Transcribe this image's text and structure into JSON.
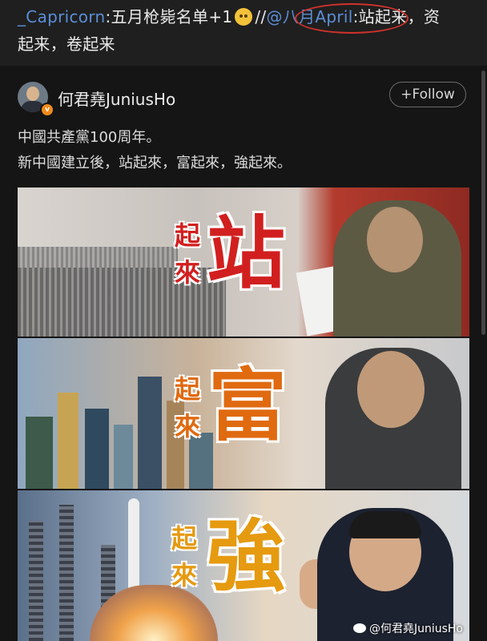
{
  "repost": {
    "author": "_Capricorn",
    "colon1": ":",
    "text1": "五月枪毙名单+1",
    "sep": "//",
    "mention": "@八月April",
    "colon2": ":",
    "text2": "站起来，资起来，卷起来"
  },
  "post": {
    "username": "何君堯JuniusHo",
    "verified_badge": "v",
    "follow_label": "+Follow",
    "line1": "中國共產黨100周年。",
    "line2": "新中國建立後，站起來，富起來，強起來。"
  },
  "image": {
    "panel1": {
      "small1": "起",
      "small2": "來",
      "big": "站",
      "color_small": "#d11f1f",
      "color_big": "#d11f1f"
    },
    "panel2": {
      "small1": "起",
      "small2": "來",
      "big": "富",
      "color_small": "#e06a10",
      "color_big": "#e06a10"
    },
    "panel3": {
      "small1": "起",
      "small2": "來",
      "big": "強",
      "color_small": "#e59a10",
      "color_big": "#e59a10"
    },
    "watermark": "@何君堯JuniusHo"
  },
  "colors": {
    "background": "#151515",
    "mention": "#5b8fd8",
    "highlight_circle": "#d0322b",
    "verified": "#f08a1c"
  },
  "icons": [
    "doge-emoji-icon",
    "verified-badge-icon",
    "weibo-logo-icon"
  ]
}
